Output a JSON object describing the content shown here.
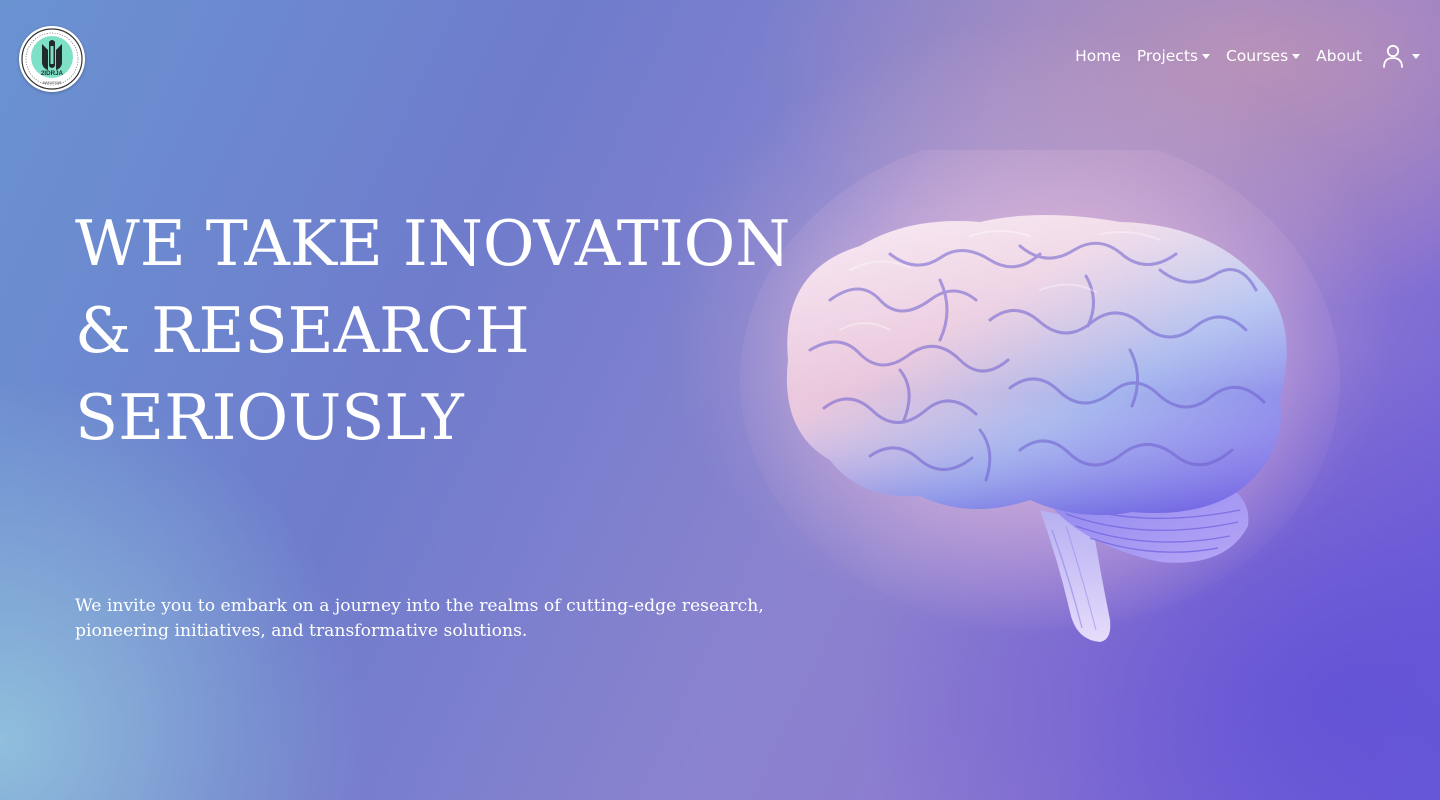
{
  "header": {
    "logo": {
      "label": "2IDRJA",
      "subtext": "MAKASSAR",
      "icon": "crest-emblem-icon",
      "accent": "#7fe0c8"
    },
    "nav": [
      {
        "label": "Home",
        "dropdown": false
      },
      {
        "label": "Projects",
        "dropdown": true
      },
      {
        "label": "Courses",
        "dropdown": true
      },
      {
        "label": "About",
        "dropdown": false
      }
    ],
    "user_menu": {
      "icon": "user-icon",
      "dropdown": true
    }
  },
  "hero": {
    "title_lines": [
      "WE TAKE INOVATION",
      "& RESEARCH",
      "SERIOUSLY"
    ],
    "subtitle_lines": [
      "We invite you to embark on a journey into the realms of cutting-edge research,",
      "pioneering initiatives, and transformative solutions."
    ],
    "image": "brain-illustration"
  },
  "colors": {
    "text": "#ffffff",
    "background_start": "#6a93d2",
    "background_end": "#6c5ddb",
    "glow": "#eec4d6"
  }
}
